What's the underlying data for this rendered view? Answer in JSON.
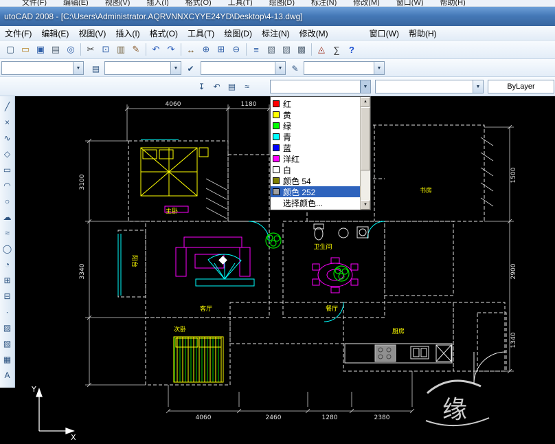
{
  "background_menubar": {
    "items": [
      "文件(F)",
      "编辑(E)",
      "视图(V)",
      "插入(I)",
      "格式(O)",
      "工具(T)",
      "绘图(D)",
      "标注(N)",
      "修改(M)",
      "窗口(W)",
      "帮助(H)"
    ]
  },
  "titlebar": {
    "title": "utoCAD 2008 - [C:\\Users\\Administrator.AQRVNNXCYYE24YD\\Desktop\\4-13.dwg]"
  },
  "menubar": {
    "items": [
      "文件(F)",
      "编辑(E)",
      "视图(V)",
      "插入(I)",
      "格式(O)",
      "工具(T)",
      "绘图(D)",
      "标注(N)",
      "修改(M)"
    ],
    "items_right": [
      "窗口(W)",
      "帮助(H)"
    ]
  },
  "ui": {
    "combo_arrow": "▼",
    "scroll_up": "▲",
    "scroll_down": "▼"
  },
  "standard_toolbar": {
    "buttons": [
      {
        "name": "qnew",
        "glyph": "▢",
        "color": "#46637f"
      },
      {
        "name": "open",
        "glyph": "▭",
        "color": "#b8862f"
      },
      {
        "name": "save",
        "glyph": "▣",
        "color": "#2f5fa8"
      },
      {
        "name": "plot",
        "glyph": "▤",
        "color": "#5a6a7a"
      },
      {
        "name": "plot-preview",
        "glyph": "◎",
        "color": "#2f5fa8"
      },
      {
        "name": "cut",
        "glyph": "✂",
        "color": "#3d3d3d"
      },
      {
        "name": "copy",
        "glyph": "⊡",
        "color": "#2f5fa8"
      },
      {
        "name": "paste",
        "glyph": "▥",
        "color": "#7a6a4a"
      },
      {
        "name": "match-properties",
        "glyph": "✎",
        "color": "#8a5a2a"
      },
      {
        "name": "undo",
        "glyph": "↶",
        "color": "#2458b8"
      },
      {
        "name": "redo",
        "glyph": "↷",
        "color": "#2458b8"
      },
      {
        "name": "pan",
        "glyph": "↔",
        "color": "#7a5a2a"
      },
      {
        "name": "zoom-realtime",
        "glyph": "⊕",
        "color": "#2f5fa8"
      },
      {
        "name": "zoom-window",
        "glyph": "⊞",
        "color": "#2f5fa8"
      },
      {
        "name": "zoom-previous",
        "glyph": "⊖",
        "color": "#2f5fa8"
      },
      {
        "name": "properties",
        "glyph": "≡",
        "color": "#2f5fa8"
      },
      {
        "name": "designcenter",
        "glyph": "▧",
        "color": "#5a6a7a"
      },
      {
        "name": "tool-palettes",
        "glyph": "▨",
        "color": "#5a6a7a"
      },
      {
        "name": "sheet-set-manager",
        "glyph": "▩",
        "color": "#5a6a7a"
      },
      {
        "name": "markup",
        "glyph": "◬",
        "color": "#a03828"
      },
      {
        "name": "quickcalc",
        "glyph": "∑",
        "color": "#333333"
      },
      {
        "name": "help",
        "glyph": "?",
        "color": "#1a4fd0"
      }
    ]
  },
  "layers_toolbar": {
    "combos": [
      {
        "name": "workspaces",
        "value": ""
      },
      {
        "name": "layer",
        "value": ""
      },
      {
        "name": "text-style",
        "value": ""
      },
      {
        "name": "dim-style",
        "value": ""
      }
    ],
    "icons": [
      {
        "name": "layer-properties-manager",
        "glyph": "▤"
      },
      {
        "name": "make-current",
        "glyph": "✔"
      },
      {
        "name": "style-edit",
        "glyph": "✎"
      }
    ]
  },
  "properties_toolbar": {
    "icons": [
      {
        "name": "make-object-layer-current",
        "glyph": "↧"
      },
      {
        "name": "layer-previous",
        "glyph": "↶"
      },
      {
        "name": "layer-states",
        "glyph": "▤"
      },
      {
        "name": "layer-match",
        "glyph": "≈"
      }
    ],
    "color_value": "",
    "linetype_value": "",
    "lineweight_value": "ByLayer"
  },
  "color_dropdown": {
    "selected_label": "颜色 252",
    "items": [
      {
        "label": "红",
        "swatch": "#ff0000"
      },
      {
        "label": "黄",
        "swatch": "#ffff00"
      },
      {
        "label": "绿",
        "swatch": "#00ff00"
      },
      {
        "label": "青",
        "swatch": "#00ffff"
      },
      {
        "label": "蓝",
        "swatch": "#0000ff"
      },
      {
        "label": "洋红",
        "swatch": "#ff00ff"
      },
      {
        "label": "白",
        "swatch": "#ffffff"
      },
      {
        "label": "颜色 54",
        "swatch": "#7f7f00"
      },
      {
        "label": "颜色 252",
        "swatch": "#a0a0a0"
      },
      {
        "label": "选择颜色...",
        "swatch": null
      }
    ]
  },
  "left_toolbar": {
    "buttons": [
      {
        "name": "line",
        "glyph": "╱"
      },
      {
        "name": "construction-line",
        "glyph": "×"
      },
      {
        "name": "polyline",
        "glyph": "∿"
      },
      {
        "name": "polygon",
        "glyph": "◇"
      },
      {
        "name": "rectangle",
        "glyph": "▭"
      },
      {
        "name": "arc",
        "glyph": "◠"
      },
      {
        "name": "circle",
        "glyph": "○"
      },
      {
        "name": "revision-cloud",
        "glyph": "☁"
      },
      {
        "name": "spline",
        "glyph": "≈"
      },
      {
        "name": "ellipse",
        "glyph": "◯"
      },
      {
        "name": "ellipse-arc",
        "glyph": "◔"
      },
      {
        "name": "insert-block",
        "glyph": "⊞"
      },
      {
        "name": "make-block",
        "glyph": "⊟"
      },
      {
        "name": "point",
        "glyph": "∙"
      },
      {
        "name": "hatch",
        "glyph": "▨"
      },
      {
        "name": "gradient",
        "glyph": "▧"
      },
      {
        "name": "table",
        "glyph": "▦"
      },
      {
        "name": "multiline-text",
        "glyph": "A"
      }
    ]
  },
  "canvas": {
    "dims": {
      "top": [
        "4060",
        "1180"
      ],
      "left": [
        "3100",
        "3340"
      ],
      "right": [
        "1500",
        "2900",
        "1340"
      ],
      "bottom": [
        "4060",
        "2460",
        "1280",
        "2380"
      ]
    },
    "rooms": {
      "balcony": "阳台",
      "master": "主卧",
      "study": "书房",
      "living": "客厅",
      "dining": "餐厅",
      "kitchen": "厨房",
      "second": "次卧",
      "bath": "卫生间"
    },
    "ucs": {
      "x": "X",
      "y": "Y"
    },
    "watermark": "缘"
  }
}
